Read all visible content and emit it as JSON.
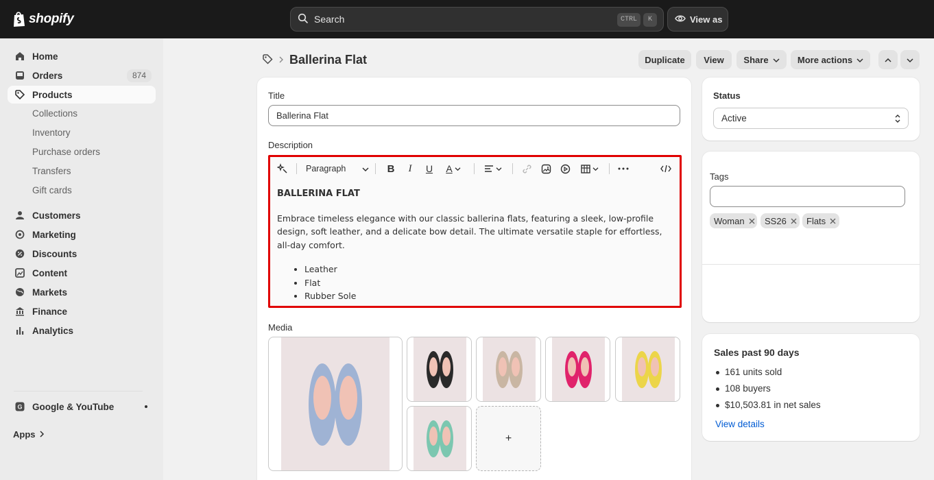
{
  "topbar": {
    "brand": "shopify",
    "search_placeholder": "Search",
    "shortcut_ctrl": "CTRL",
    "shortcut_k": "K",
    "view_as": "View as"
  },
  "sidebar": {
    "home": "Home",
    "orders": "Orders",
    "orders_count": "874",
    "products": "Products",
    "sub": [
      "Collections",
      "Inventory",
      "Purchase orders",
      "Transfers",
      "Gift cards"
    ],
    "customers": "Customers",
    "marketing": "Marketing",
    "discounts": "Discounts",
    "content": "Content",
    "markets": "Markets",
    "finance": "Finance",
    "analytics": "Analytics",
    "channel": "Google & YouTube",
    "apps": "Apps"
  },
  "header": {
    "title": "Ballerina Flat",
    "duplicate": "Duplicate",
    "view": "View",
    "share": "Share",
    "more_actions": "More actions"
  },
  "product": {
    "title_label": "Title",
    "title_value": "Ballerina Flat",
    "description_label": "Description",
    "format_select": "Paragraph",
    "desc_heading": "BALLERINA FLAT",
    "desc_paragraph": "Embrace timeless elegance with our classic ballerina flats, featuring a sleek, low-profile design, soft leather, and a delicate bow detail. The ultimate versatile staple for effortless, all-day comfort.",
    "desc_bullets": [
      "Leather",
      "Flat",
      "Rubber Sole"
    ],
    "media_label": "Media",
    "add_media": "+"
  },
  "status": {
    "label": "Status",
    "value": "Active"
  },
  "tags": {
    "label": "Tags",
    "items": [
      "Woman",
      "SS26",
      "Flats"
    ]
  },
  "sales": {
    "title": "Sales past 90 days",
    "items": [
      "161 units sold",
      "108 buyers",
      "$10,503.81 in net sales"
    ],
    "link": "View details"
  },
  "colors": {
    "accent_link": "#005bd3",
    "highlight_border": "#e00000",
    "topbar": "#1a1a1a"
  }
}
